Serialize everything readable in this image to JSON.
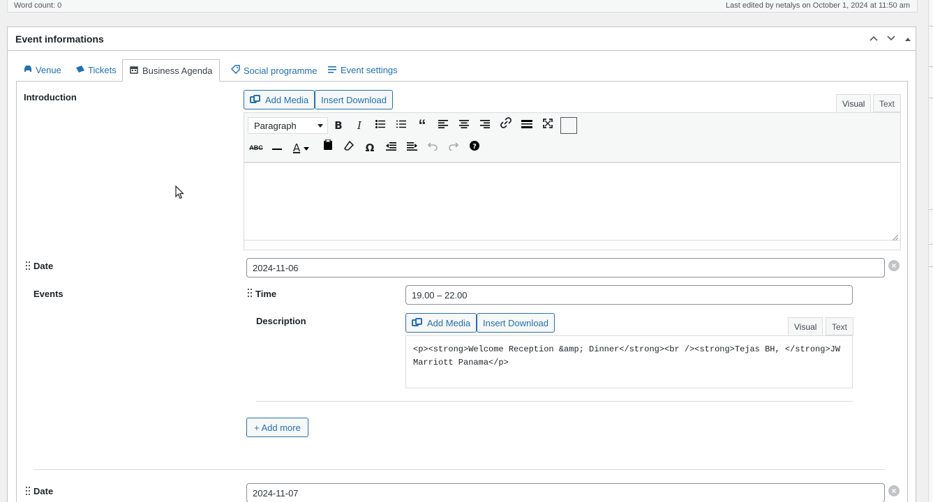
{
  "status_bar": {
    "word_count": "Word count: 0",
    "last_edited": "Last edited by netalys on October 1, 2024 at 11:50 am"
  },
  "postbox": {
    "title": "Event informations",
    "controls": [
      "move-up",
      "move-down",
      "toggle"
    ]
  },
  "tabs": [
    {
      "label": "Venue",
      "icon": "car-icon"
    },
    {
      "label": "Tickets",
      "icon": "tickets-icon"
    },
    {
      "label": "Business Agenda",
      "icon": "calendar-icon",
      "active": true
    },
    {
      "label": "Social programme",
      "icon": "tag-icon"
    },
    {
      "label": "Event settings",
      "icon": "list-icon"
    }
  ],
  "introduction": {
    "label": "Introduction",
    "add_media": "Add Media",
    "insert_download": "Insert Download",
    "visual_tab": "Visual",
    "text_tab": "Text",
    "format_select": "Paragraph"
  },
  "day1": {
    "date_label": "Date",
    "date_value": "2024-11-06",
    "events_label": "Events",
    "time_label": "Time",
    "time_value": "19.00 – 22.00",
    "description_label": "Description",
    "add_media": "Add Media",
    "insert_download": "Insert Download",
    "visual_tab": "Visual",
    "text_tab": "Text",
    "description_value": "<p><strong>Welcome Reception &amp; Dinner</strong><br /><strong>Tejas BH, </strong>JW Marriott Panama</p>",
    "add_more": "+ Add more"
  },
  "day2": {
    "date_label": "Date",
    "date_value": "2024-11-07"
  },
  "colors": {
    "accent": "#2271b1",
    "border": "#c3c4c7",
    "background": "#f0f0f1"
  }
}
